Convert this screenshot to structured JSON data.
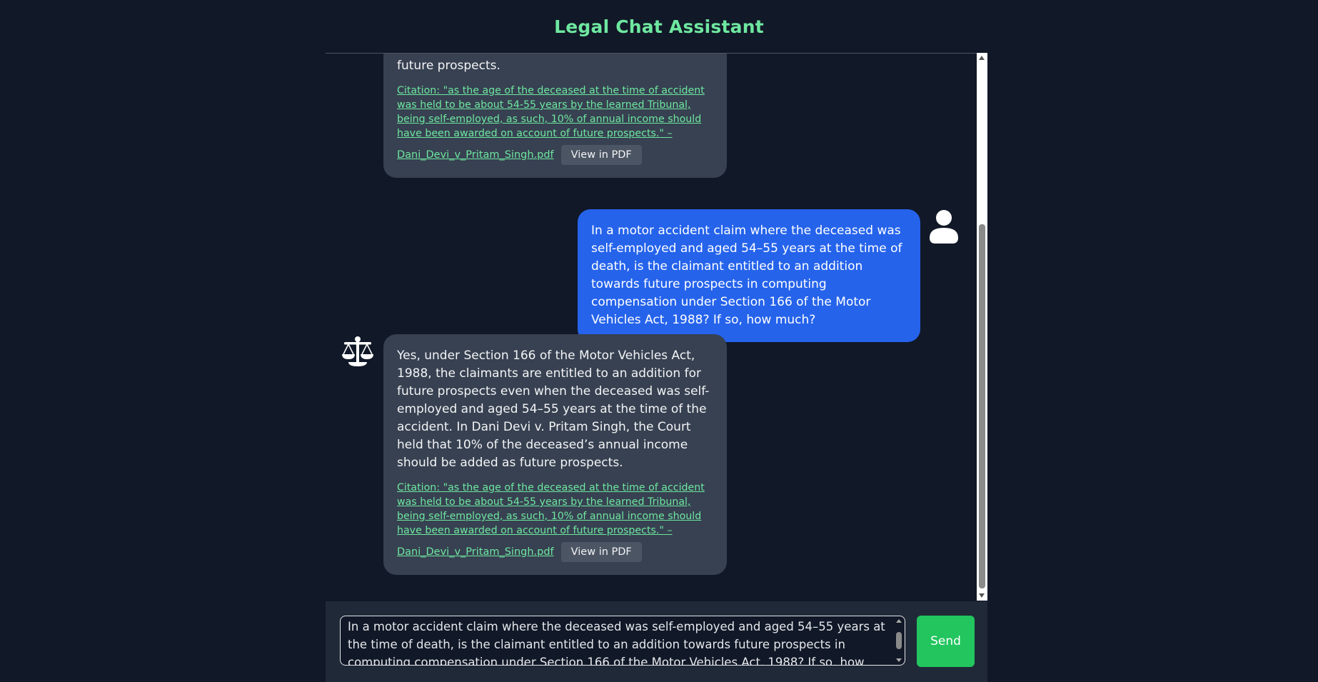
{
  "app": {
    "title": "Legal Chat Assistant"
  },
  "messages": [
    {
      "role": "assistant",
      "text": "the deceased’s annual income should be added as future prospects.",
      "citation": "Citation: \"as the age of the deceased at the time of accident was held to be about 54-55 years by the learned Tribunal, being self-employed, as such, 10% of annual income should have been awarded on account of future prospects.\" –",
      "file": "Dani_Devi_v_Pritam_Singh.pdf",
      "pdf_button": "View in PDF"
    },
    {
      "role": "user",
      "text": "In a motor accident claim where the deceased was self-employed and aged 54–55 years at the time of death, is the claimant entitled to an addition towards future prospects in computing compensation under Section 166 of the Motor Vehicles Act, 1988? If so, how much?"
    },
    {
      "role": "assistant",
      "text": "Yes, under Section 166 of the Motor Vehicles Act, 1988, the claimants are entitled to an addition for future prospects even when the deceased was self-employed and aged 54–55 years at the time of the accident. In Dani Devi v. Pritam Singh, the Court held that 10% of the deceased’s annual income should be added as future prospects.",
      "citation": "Citation: \"as the age of the deceased at the time of accident was held to be about 54-55 years by the learned Tribunal, being self-employed, as such, 10% of annual income should have been awarded on account of future prospects.\" –",
      "file": "Dani_Devi_v_Pritam_Singh.pdf",
      "pdf_button": "View in PDF"
    }
  ],
  "input": {
    "value": "In a motor accident claim where the deceased was self-employed and aged 54–55 years at the time of death, is the claimant entitled to an addition towards future prospects in computing compensation under Section 166 of the Motor Vehicles Act, 1988? If so, how much?",
    "send_label": "Send"
  },
  "icons": {
    "user_avatar": "user-icon",
    "assistant_avatar": "scales-of-justice-icon"
  },
  "colors": {
    "accent": "#6ee7a0",
    "user_bubble": "#2563eb",
    "assistant_bubble": "#374151",
    "send": "#22c55e"
  }
}
